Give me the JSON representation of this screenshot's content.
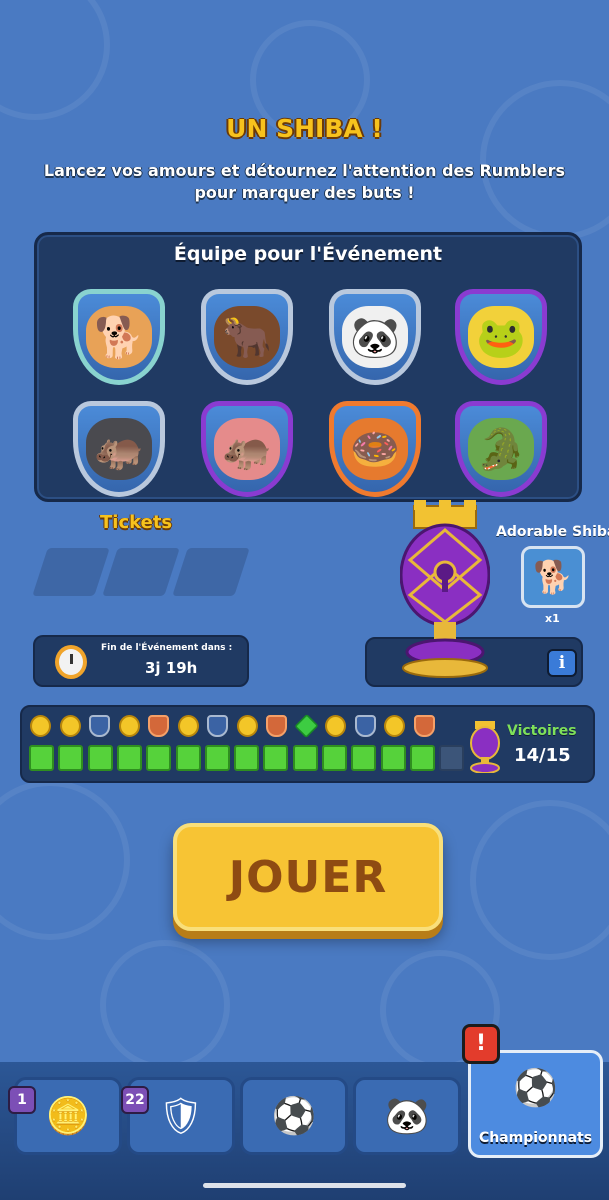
{
  "event": {
    "title": "UN SHIBA !",
    "description": "Lancez vos amours et détournez l'attention des Rumblers pour marquer des buts !"
  },
  "team": {
    "title": "Équipe pour l'Événement",
    "members": [
      {
        "icon": "shiba-icon",
        "glyph": "🐕",
        "frame": "teal"
      },
      {
        "icon": "bull-icon",
        "glyph": "🐂",
        "frame": "silver"
      },
      {
        "icon": "panda-icon",
        "glyph": "🐼",
        "frame": "silver"
      },
      {
        "icon": "frog-icon",
        "glyph": "🐸",
        "frame": "purple"
      },
      {
        "icon": "cannon-hippo-icon",
        "glyph": "🦛",
        "frame": "silver"
      },
      {
        "icon": "hippo-icon",
        "glyph": "🦛",
        "frame": "purple"
      },
      {
        "icon": "donut-hippo-icon",
        "glyph": "🍩",
        "frame": "orange"
      },
      {
        "icon": "crocodile-icon",
        "glyph": "🐊",
        "frame": "purple"
      }
    ]
  },
  "tickets": {
    "label": "Tickets",
    "count": 3
  },
  "timer": {
    "label": "Fin de l'Événement dans :",
    "value": "3j 19h"
  },
  "reward": {
    "name": "Adorable Shiba",
    "quantity": "x1",
    "info_label": "i"
  },
  "progress": {
    "milestones": [
      "coin",
      "coin",
      "shield-blue",
      "coin",
      "shield-orange",
      "coin",
      "shield-blue",
      "coin",
      "shield-orange",
      "gem",
      "coin",
      "shield-blue",
      "coin",
      "shield-orange"
    ],
    "completed": 14,
    "total": 15,
    "victories_label": "Victoires",
    "victories_value": "14/15"
  },
  "play_button": {
    "label": "JOUER"
  },
  "nav": {
    "tabs": [
      {
        "name": "shop",
        "icon": "coins-icon",
        "glyph": "🪙",
        "badge": "1"
      },
      {
        "name": "inventory",
        "icon": "cards-icon",
        "glyph": "🛡",
        "badge": "22"
      },
      {
        "name": "play",
        "icon": "soccer-ball-icon",
        "glyph": "⚽",
        "badge": ""
      },
      {
        "name": "team",
        "icon": "panda-shield-icon",
        "glyph": "🐼",
        "badge": ""
      }
    ],
    "active": {
      "label": "Championnats",
      "icon": "winged-ball-icon",
      "glyph": "⚽",
      "alert": "!"
    }
  }
}
